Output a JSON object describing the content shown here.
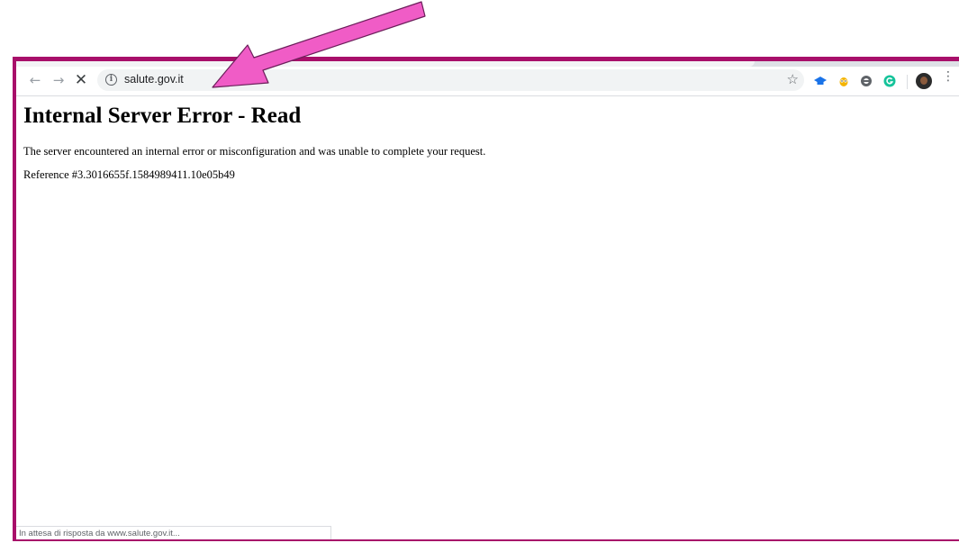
{
  "browser": {
    "url": "salute.gov.it",
    "back_icon": "←",
    "forward_icon": "→",
    "stop_icon": "✕",
    "info_icon": "i",
    "bookmark_icon": "☆",
    "menu_icon": "⋮",
    "extensions": [
      "graduation-cap-icon",
      "owl-icon",
      "ring-icon",
      "grammarly-icon"
    ]
  },
  "page": {
    "heading": "Internal Server Error - Read",
    "message": "The server encountered an internal error or misconfiguration and was unable to complete your request.",
    "reference": "Reference #3.3016655f.1584989411.10e05b49"
  },
  "status": {
    "text": "In attesa di risposta da www.salute.gov.it..."
  },
  "colors": {
    "frame_border": "#a80f6a",
    "annotation_arrow": "#f05cc6"
  }
}
